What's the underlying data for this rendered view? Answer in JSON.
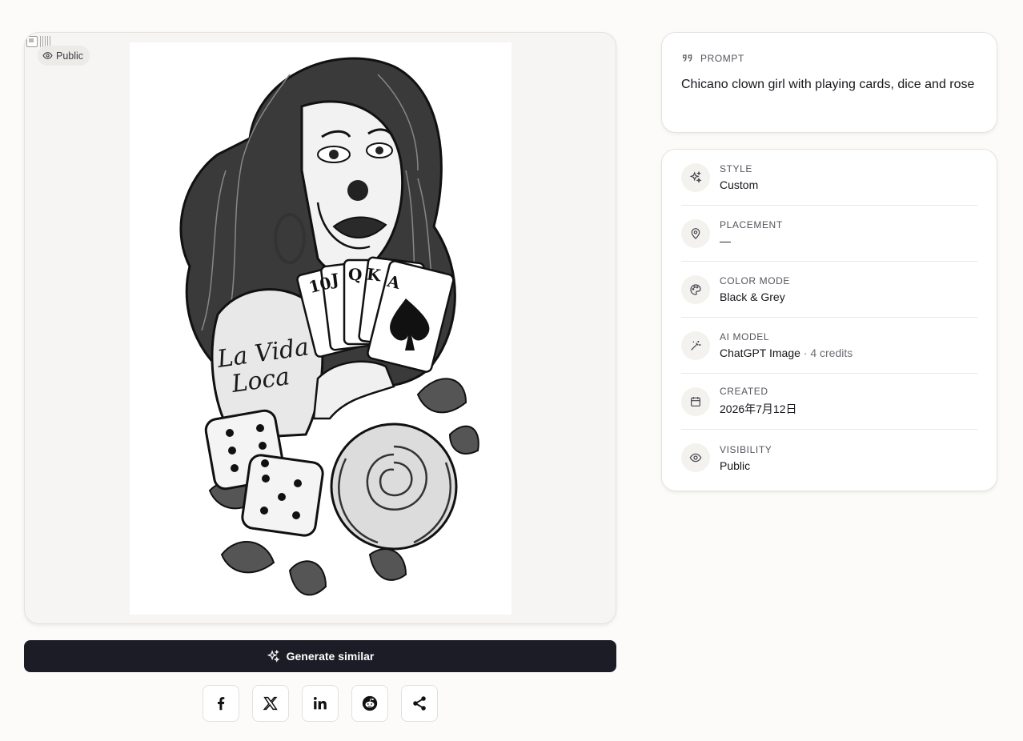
{
  "image": {
    "badge_label": "Public",
    "tattoo_text": [
      "La Vida",
      "Loca"
    ],
    "card_ranks": [
      "10",
      "J",
      "Q",
      "K",
      "A"
    ]
  },
  "actions": {
    "generate_label": "Generate similar",
    "share": [
      {
        "name": "facebook-share-button",
        "icon": "facebook-icon"
      },
      {
        "name": "x-share-button",
        "icon": "x-icon"
      },
      {
        "name": "linkedin-share-button",
        "icon": "linkedin-icon"
      },
      {
        "name": "reddit-share-button",
        "icon": "reddit-icon"
      },
      {
        "name": "share-button",
        "icon": "share-icon"
      }
    ]
  },
  "prompt": {
    "label": "PROMPT",
    "icon": "quote-icon",
    "text": "Chicano clown girl with playing cards, dice and rose"
  },
  "meta": [
    {
      "icon": "sparkles-icon",
      "label": "STYLE",
      "value": "Custom"
    },
    {
      "icon": "map-pin-icon",
      "label": "PLACEMENT",
      "value": "—"
    },
    {
      "icon": "palette-icon",
      "label": "COLOR MODE",
      "value": "Black & Grey"
    },
    {
      "icon": "magic-wand-icon",
      "label": "AI MODEL",
      "value": "ChatGPT Image",
      "sub": " · 4 credits"
    },
    {
      "icon": "calendar-icon",
      "label": "CREATED",
      "value": "2026年7月12日"
    },
    {
      "icon": "eye-icon",
      "label": "VISIBILITY",
      "value": "Public"
    }
  ],
  "colors": {
    "background": "#fcfbf9",
    "button": "#1c1c26",
    "ink": "#17171d",
    "muted": "#55555e"
  }
}
